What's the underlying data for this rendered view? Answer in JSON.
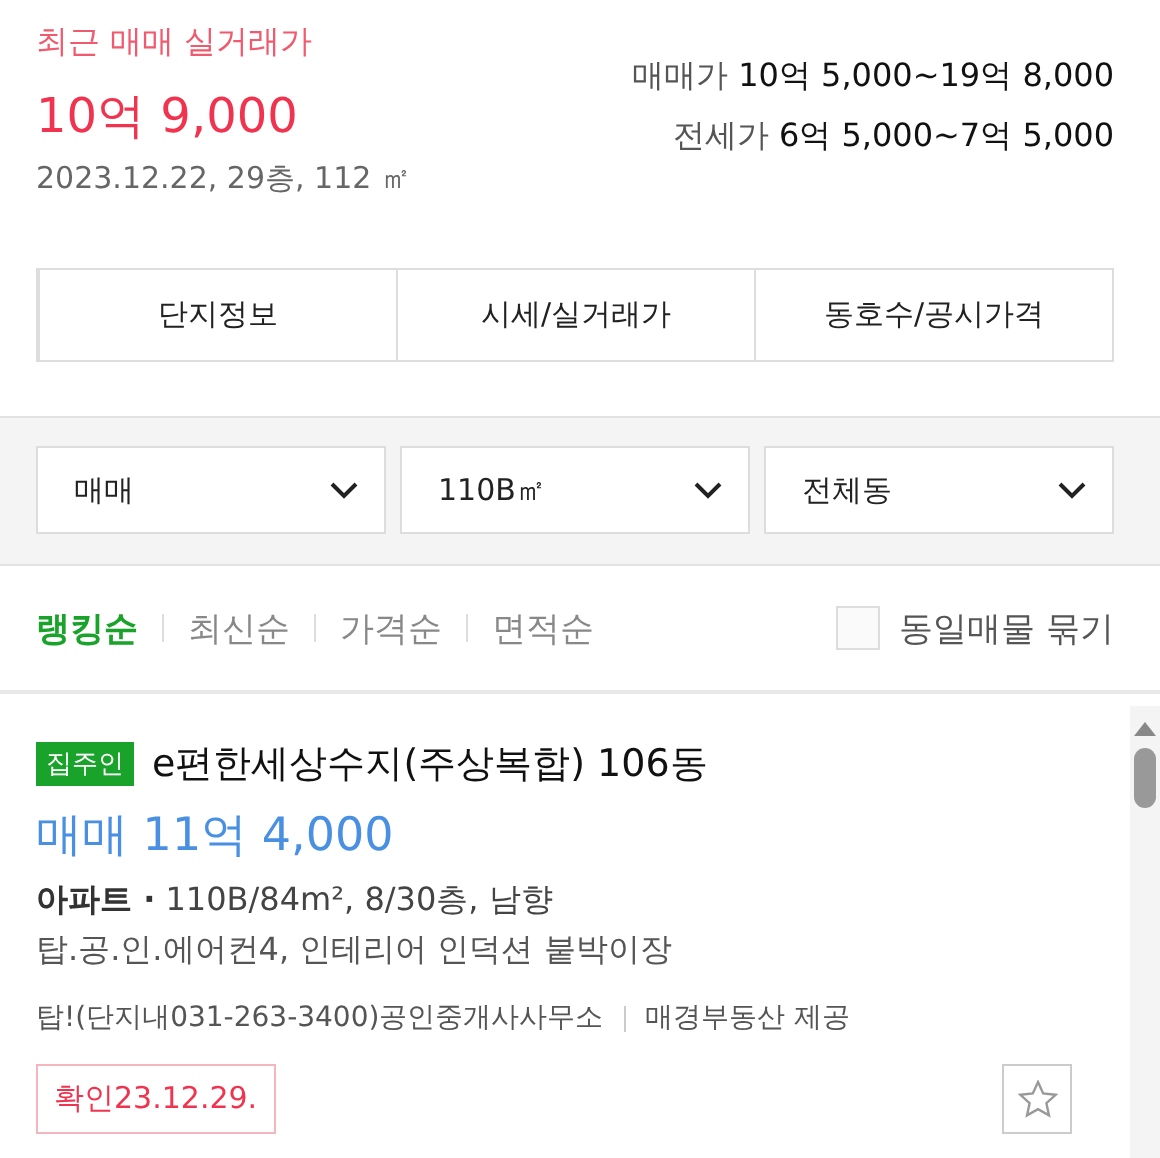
{
  "recent_trade": {
    "title": "최근 매매 실거래가",
    "price": "10억 9,000",
    "details": "2023.12.22, 29층, 112 ㎡"
  },
  "price_ranges": [
    {
      "label": "매매가",
      "value": "10억 5,000~19억 8,000"
    },
    {
      "label": "전세가",
      "value": "6억 5,000~7억 5,000"
    }
  ],
  "tabs": [
    {
      "label": "단지정보"
    },
    {
      "label": "시세/실거래가"
    },
    {
      "label": "동호수/공시가격"
    }
  ],
  "filters": [
    {
      "value": "매매"
    },
    {
      "value": "110B㎡"
    },
    {
      "value": "전체동"
    }
  ],
  "sort_options": [
    {
      "label": "랭킹순",
      "selected": true
    },
    {
      "label": "최신순",
      "selected": false
    },
    {
      "label": "가격순",
      "selected": false
    },
    {
      "label": "면적순",
      "selected": false
    }
  ],
  "group_same_listings": {
    "label": "동일매물 묶기",
    "checked": false
  },
  "listing": {
    "badge": "집주인",
    "title": "e편한세상수지(주상복합) 106동",
    "price": "매매 11억 4,000",
    "type": "아파트 ·",
    "specs": "110B/84m², 8/30층, 남향",
    "description": "탑.공.인.에어컨4, 인테리어 인덕션 붙박이장",
    "agent": "탑!(단지내031-263-3400)공인중개사사무소",
    "provider": "매경부동산 제공",
    "confirmed": "확인23.12.29.",
    "favorite": false
  }
}
